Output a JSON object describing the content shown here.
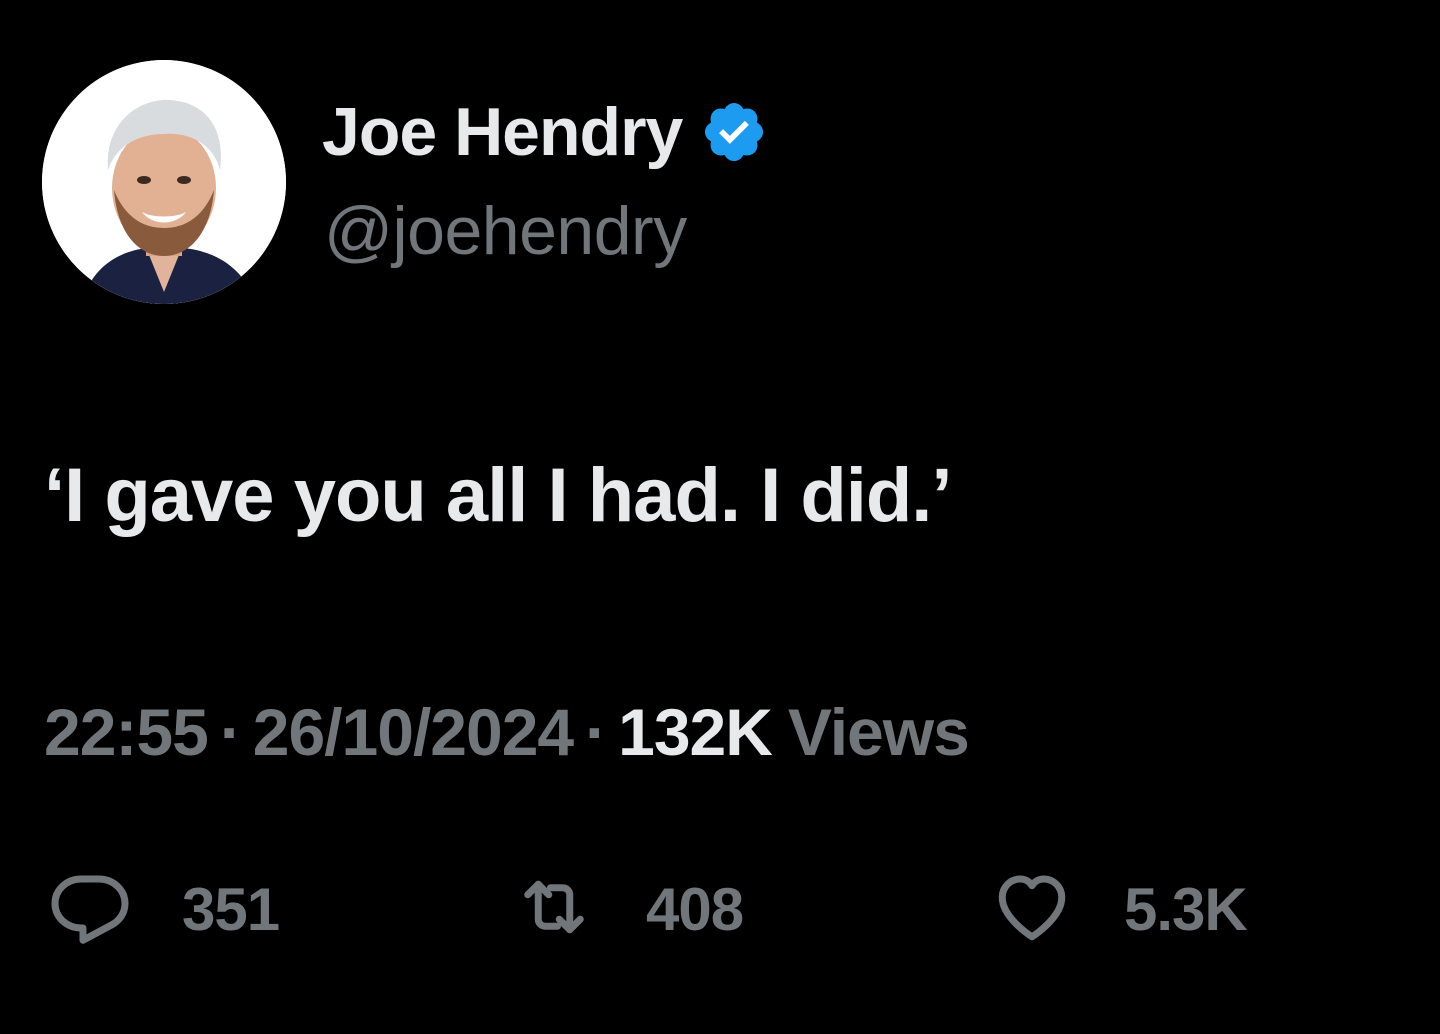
{
  "author": {
    "display_name": "Joe Hendry",
    "handle": "@joehendry",
    "verified_color": "#1d9bf0",
    "avatar_icon": "profile-photo"
  },
  "tweet": {
    "text": "‘I gave you all I had. I did.’"
  },
  "meta": {
    "time": "22:55",
    "separator": "·",
    "date": "26/10/2024",
    "views_count": "132K",
    "views_label": "Views"
  },
  "actions": {
    "reply": {
      "icon": "reply-icon",
      "count": "351"
    },
    "retweet": {
      "icon": "retweet-icon",
      "count": "408"
    },
    "like": {
      "icon": "heart-icon",
      "count": "5.3K"
    }
  },
  "colors": {
    "background": "#000000",
    "text_primary": "#e7e9ea",
    "text_muted": "#71767b",
    "accent": "#1d9bf0"
  }
}
